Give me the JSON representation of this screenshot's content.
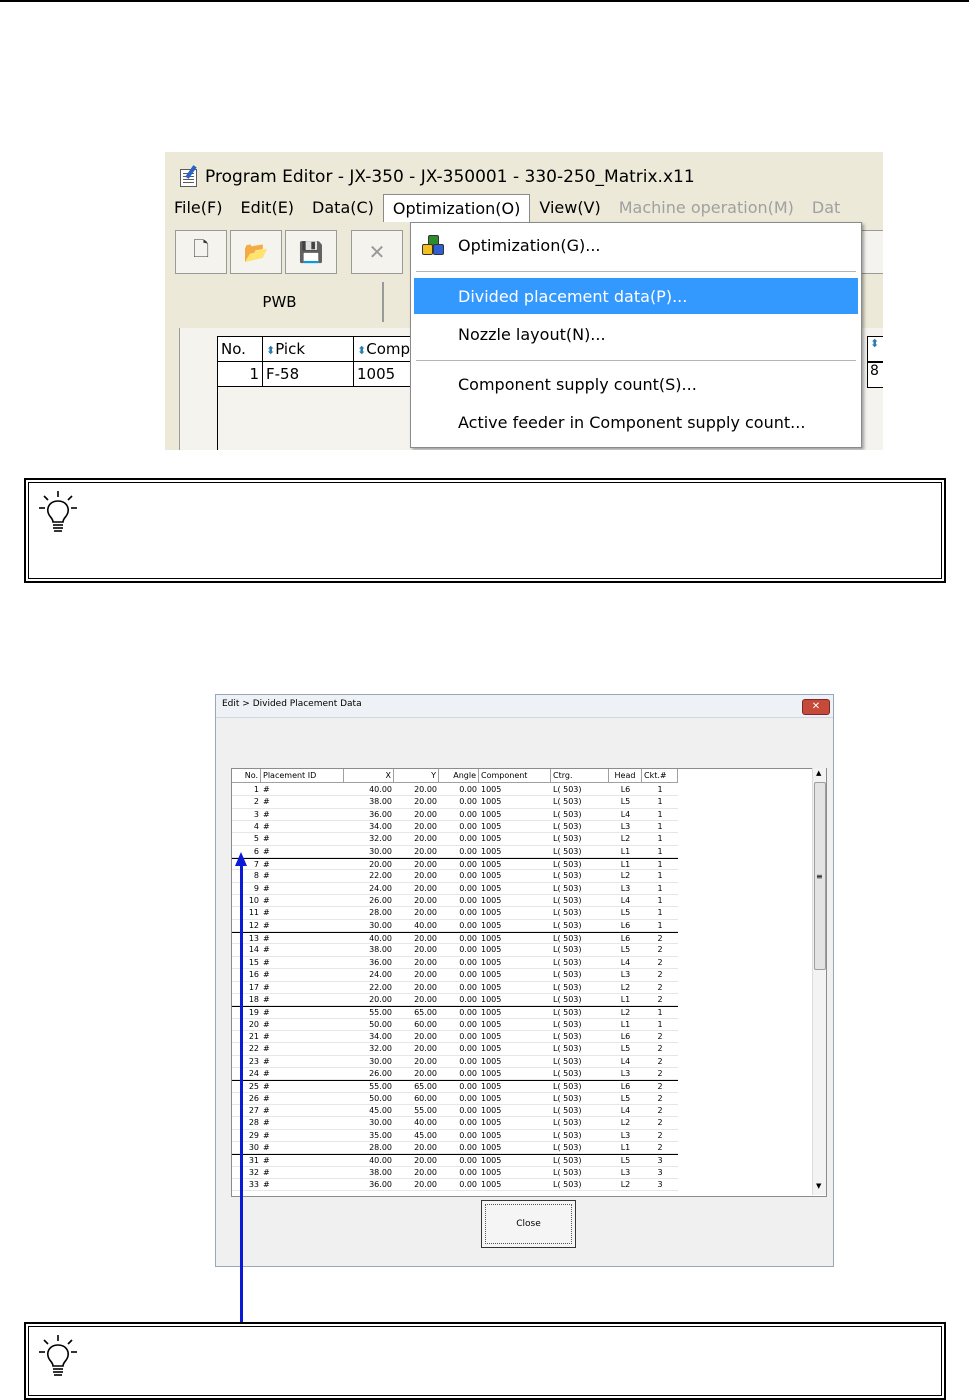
{
  "program_editor": {
    "title": "Program Editor - JX-350 - JX-350001 - 330-250_Matrix.x11",
    "menubar": [
      "File(F)",
      "Edit(E)",
      "Data(C)",
      "Optimization(O)",
      "View(V)",
      "Machine operation(M)",
      "Dat"
    ],
    "toolbar_icons": [
      "new-file-icon",
      "open-folder-icon",
      "save-icon",
      "delete-icon"
    ],
    "tab_label": "PWB",
    "grid": {
      "headers": [
        "No.",
        "Pick",
        "Comp"
      ],
      "row": [
        "1",
        "F-58",
        "1005"
      ],
      "right_cell": "8"
    },
    "optimization_menu": {
      "items": [
        {
          "label": "Optimization(G)...",
          "icon": "optimization-icon"
        },
        {
          "label": "Divided placement data(P)...",
          "selected": true
        },
        {
          "label": "Nozzle layout(N)..."
        },
        {
          "label": "Component supply count(S)..."
        },
        {
          "label": "Active feeder in Component supply count..."
        }
      ]
    },
    "highlight_color": "#3399ff"
  },
  "dialog": {
    "title": "Edit > Divided Placement Data",
    "close_button": "Close",
    "columns": [
      "No.",
      "Placement ID",
      "X",
      "Y",
      "Angle",
      "Component",
      "Ctrg.",
      "Head",
      "Ckt.#"
    ],
    "rows": [
      [
        "1",
        "#",
        "40.00",
        "20.00",
        "0.00",
        "1005",
        "L( 503)",
        "L6",
        "1"
      ],
      [
        "2",
        "#",
        "38.00",
        "20.00",
        "0.00",
        "1005",
        "L( 503)",
        "L5",
        "1"
      ],
      [
        "3",
        "#",
        "36.00",
        "20.00",
        "0.00",
        "1005",
        "L( 503)",
        "L4",
        "1"
      ],
      [
        "4",
        "#",
        "34.00",
        "20.00",
        "0.00",
        "1005",
        "L( 503)",
        "L3",
        "1"
      ],
      [
        "5",
        "#",
        "32.00",
        "20.00",
        "0.00",
        "1005",
        "L( 503)",
        "L2",
        "1"
      ],
      [
        "6",
        "#",
        "30.00",
        "20.00",
        "0.00",
        "1005",
        "L( 503)",
        "L1",
        "1"
      ],
      [
        "7",
        "#",
        "20.00",
        "20.00",
        "0.00",
        "1005",
        "L( 503)",
        "L1",
        "1"
      ],
      [
        "8",
        "#",
        "22.00",
        "20.00",
        "0.00",
        "1005",
        "L( 503)",
        "L2",
        "1"
      ],
      [
        "9",
        "#",
        "24.00",
        "20.00",
        "0.00",
        "1005",
        "L( 503)",
        "L3",
        "1"
      ],
      [
        "10",
        "#",
        "26.00",
        "20.00",
        "0.00",
        "1005",
        "L( 503)",
        "L4",
        "1"
      ],
      [
        "11",
        "#",
        "28.00",
        "20.00",
        "0.00",
        "1005",
        "L( 503)",
        "L5",
        "1"
      ],
      [
        "12",
        "#",
        "30.00",
        "40.00",
        "0.00",
        "1005",
        "L( 503)",
        "L6",
        "1"
      ],
      [
        "13",
        "#",
        "40.00",
        "20.00",
        "0.00",
        "1005",
        "L( 503)",
        "L6",
        "2"
      ],
      [
        "14",
        "#",
        "38.00",
        "20.00",
        "0.00",
        "1005",
        "L( 503)",
        "L5",
        "2"
      ],
      [
        "15",
        "#",
        "36.00",
        "20.00",
        "0.00",
        "1005",
        "L( 503)",
        "L4",
        "2"
      ],
      [
        "16",
        "#",
        "24.00",
        "20.00",
        "0.00",
        "1005",
        "L( 503)",
        "L3",
        "2"
      ],
      [
        "17",
        "#",
        "22.00",
        "20.00",
        "0.00",
        "1005",
        "L( 503)",
        "L2",
        "2"
      ],
      [
        "18",
        "#",
        "20.00",
        "20.00",
        "0.00",
        "1005",
        "L( 503)",
        "L1",
        "2"
      ],
      [
        "19",
        "#",
        "55.00",
        "65.00",
        "0.00",
        "1005",
        "L( 503)",
        "L2",
        "1"
      ],
      [
        "20",
        "#",
        "50.00",
        "60.00",
        "0.00",
        "1005",
        "L( 503)",
        "L1",
        "1"
      ],
      [
        "21",
        "#",
        "34.00",
        "20.00",
        "0.00",
        "1005",
        "L( 503)",
        "L6",
        "2"
      ],
      [
        "22",
        "#",
        "32.00",
        "20.00",
        "0.00",
        "1005",
        "L( 503)",
        "L5",
        "2"
      ],
      [
        "23",
        "#",
        "30.00",
        "20.00",
        "0.00",
        "1005",
        "L( 503)",
        "L4",
        "2"
      ],
      [
        "24",
        "#",
        "26.00",
        "20.00",
        "0.00",
        "1005",
        "L( 503)",
        "L3",
        "2"
      ],
      [
        "25",
        "#",
        "55.00",
        "65.00",
        "0.00",
        "1005",
        "L( 503)",
        "L6",
        "2"
      ],
      [
        "26",
        "#",
        "50.00",
        "60.00",
        "0.00",
        "1005",
        "L( 503)",
        "L5",
        "2"
      ],
      [
        "27",
        "#",
        "45.00",
        "55.00",
        "0.00",
        "1005",
        "L( 503)",
        "L4",
        "2"
      ],
      [
        "28",
        "#",
        "30.00",
        "40.00",
        "0.00",
        "1005",
        "L( 503)",
        "L2",
        "2"
      ],
      [
        "29",
        "#",
        "35.00",
        "45.00",
        "0.00",
        "1005",
        "L( 503)",
        "L3",
        "2"
      ],
      [
        "30",
        "#",
        "28.00",
        "20.00",
        "0.00",
        "1005",
        "L( 503)",
        "L1",
        "2"
      ],
      [
        "31",
        "#",
        "40.00",
        "20.00",
        "0.00",
        "1005",
        "L( 503)",
        "L5",
        "3"
      ],
      [
        "32",
        "#",
        "38.00",
        "20.00",
        "0.00",
        "1005",
        "L( 503)",
        "L3",
        "3"
      ],
      [
        "33",
        "#",
        "36.00",
        "20.00",
        "0.00",
        "1005",
        "L( 503)",
        "L2",
        "3"
      ]
    ],
    "group_starts": [
      7,
      13,
      19,
      25,
      31
    ]
  },
  "arrow_color": "#0a1ad6"
}
